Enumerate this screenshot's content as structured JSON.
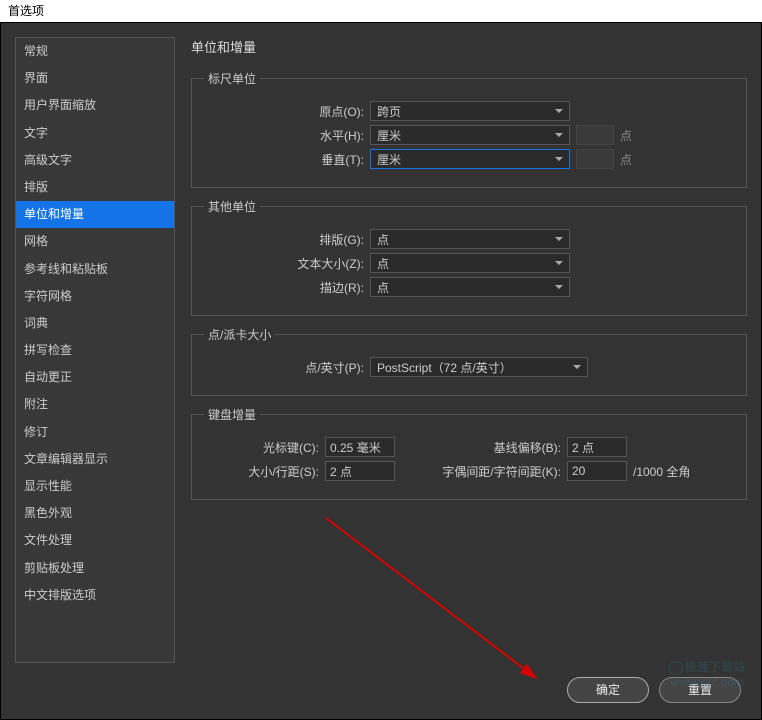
{
  "window": {
    "title": "首选项"
  },
  "sidebar": {
    "items": [
      {
        "label": "常规"
      },
      {
        "label": "界面"
      },
      {
        "label": "用户界面缩放"
      },
      {
        "label": "文字"
      },
      {
        "label": "高级文字"
      },
      {
        "label": "排版"
      },
      {
        "label": "单位和增量"
      },
      {
        "label": "网格"
      },
      {
        "label": "参考线和粘贴板"
      },
      {
        "label": "字符网格"
      },
      {
        "label": "词典"
      },
      {
        "label": "拼写检查"
      },
      {
        "label": "自动更正"
      },
      {
        "label": "附注"
      },
      {
        "label": "修订"
      },
      {
        "label": "文章编辑器显示"
      },
      {
        "label": "显示性能"
      },
      {
        "label": "黑色外观"
      },
      {
        "label": "文件处理"
      },
      {
        "label": "剪贴板处理"
      },
      {
        "label": "中文排版选项"
      }
    ],
    "selected_index": 6
  },
  "content": {
    "title": "单位和增量",
    "ruler": {
      "legend": "标尺单位",
      "origin_label": "原点(O):",
      "origin_value": "跨页",
      "horiz_label": "水平(H):",
      "horiz_value": "厘米",
      "vert_label": "垂直(T):",
      "vert_value": "厘米",
      "suffix": "点"
    },
    "other": {
      "legend": "其他单位",
      "typeset_label": "排版(G):",
      "typeset_value": "点",
      "textsize_label": "文本大小(Z):",
      "textsize_value": "点",
      "stroke_label": "描边(R):",
      "stroke_value": "点"
    },
    "pica": {
      "legend": "点/派卡大小",
      "ppi_label": "点/英寸(P):",
      "ppi_value": "PostScript（72 点/英寸）"
    },
    "kb": {
      "legend": "键盘增量",
      "cursor_label": "光标键(C):",
      "cursor_value": "0.25 毫米",
      "baseline_label": "基线偏移(B):",
      "baseline_value": "2 点",
      "size_label": "大小/行距(S):",
      "size_value": "2 点",
      "kerning_label": "字偶间距/字符间距(K):",
      "kerning_value": "20",
      "kerning_unit": "/1000 全角"
    }
  },
  "buttons": {
    "ok": "确定",
    "cancel": "重置"
  },
  "watermark": {
    "line1": "极速下载站",
    "line2": "www.xz7.com"
  }
}
